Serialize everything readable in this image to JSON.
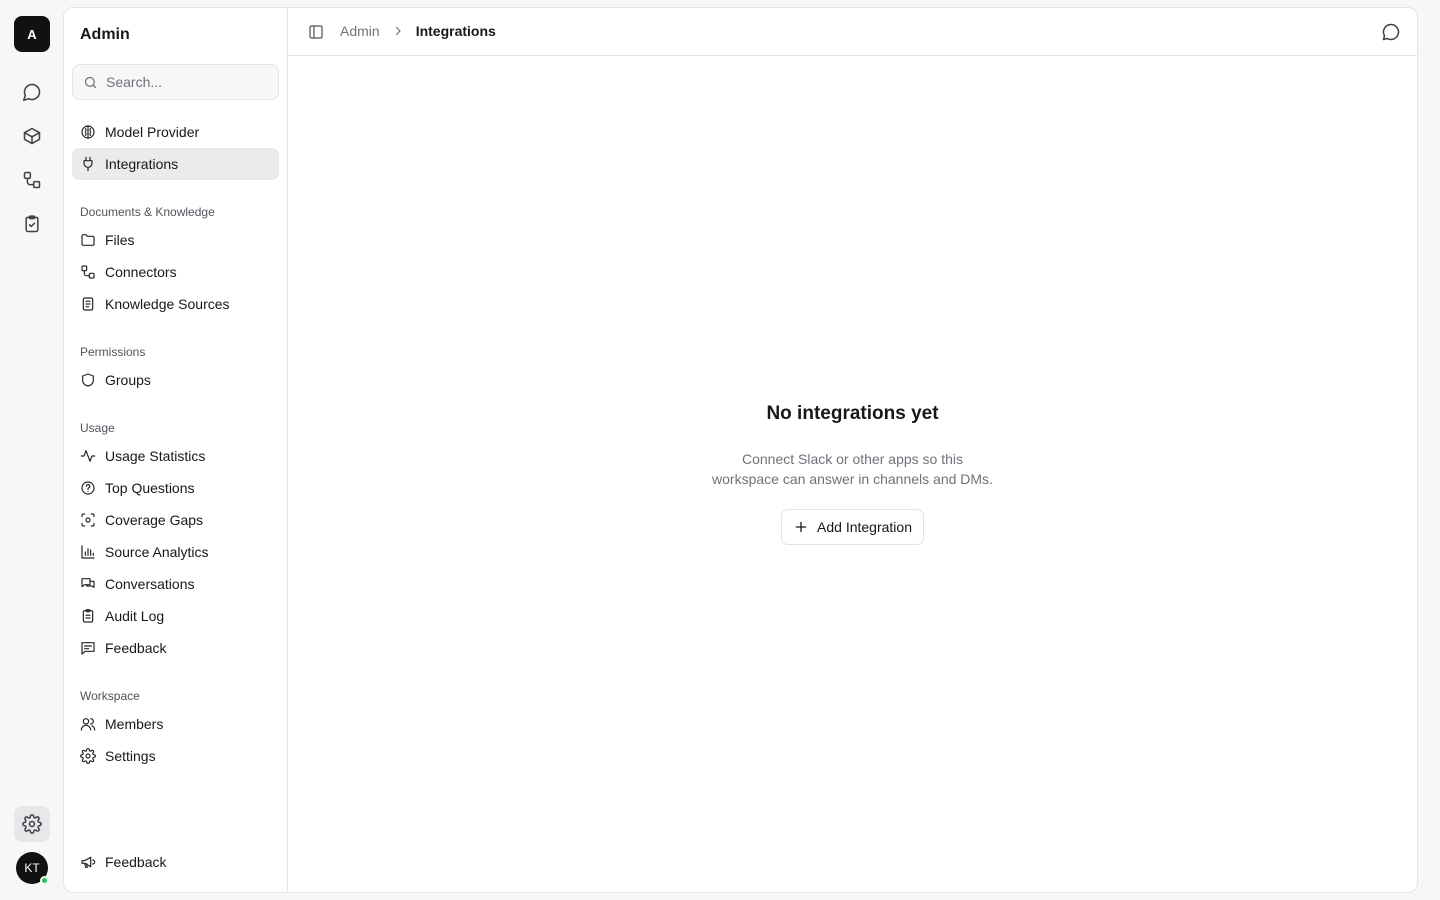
{
  "rail": {
    "logo_letter": "A",
    "items": [
      "chat-icon",
      "box-icon",
      "connectors-icon",
      "clipboard-check-icon"
    ],
    "settings_icon": "gear-icon",
    "avatar_initials": "KT",
    "online_color": "#22c55e"
  },
  "sidebar": {
    "title": "Admin",
    "search_placeholder": "Search...",
    "top_items": [
      {
        "label": "Model Provider",
        "icon": "brain-icon"
      },
      {
        "label": "Integrations",
        "icon": "plug-icon",
        "active": true
      }
    ],
    "sections": [
      {
        "label": "Documents & Knowledge",
        "items": [
          {
            "label": "Files",
            "icon": "folder-icon"
          },
          {
            "label": "Connectors",
            "icon": "connectors-icon"
          },
          {
            "label": "Knowledge Sources",
            "icon": "document-icon"
          }
        ]
      },
      {
        "label": "Permissions",
        "items": [
          {
            "label": "Groups",
            "icon": "shield-icon"
          }
        ]
      },
      {
        "label": "Usage",
        "items": [
          {
            "label": "Usage Statistics",
            "icon": "activity-icon"
          },
          {
            "label": "Top Questions",
            "icon": "question-circle-icon"
          },
          {
            "label": "Coverage Gaps",
            "icon": "scan-icon"
          },
          {
            "label": "Source Analytics",
            "icon": "bar-chart-icon"
          },
          {
            "label": "Conversations",
            "icon": "messages-icon"
          },
          {
            "label": "Audit Log",
            "icon": "clipboard-icon"
          },
          {
            "label": "Feedback",
            "icon": "message-square-icon"
          }
        ]
      },
      {
        "label": "Workspace",
        "items": [
          {
            "label": "Members",
            "icon": "users-icon"
          },
          {
            "label": "Settings",
            "icon": "gear-icon"
          }
        ]
      }
    ],
    "footer_feedback": "Feedback"
  },
  "header": {
    "breadcrumb_parent": "Admin",
    "breadcrumb_current": "Integrations"
  },
  "empty_state": {
    "title": "No integrations yet",
    "description_line1": "Connect Slack or other apps so this",
    "description_line2": "workspace can answer in channels and DMs.",
    "button_label": "Add Integration"
  }
}
